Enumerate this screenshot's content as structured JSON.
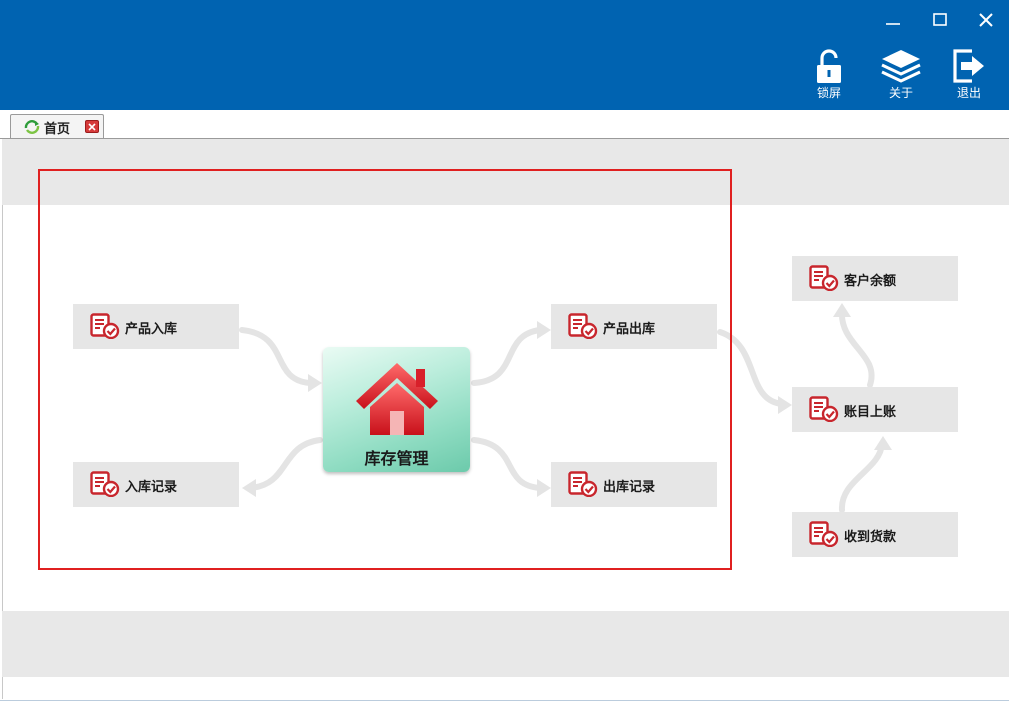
{
  "window": {
    "controls": {
      "minimize_icon": "minimize-icon",
      "maximize_icon": "maximize-icon",
      "close_icon": "close-icon"
    }
  },
  "toolbar": {
    "lock_label": "锁屏",
    "about_label": "关于",
    "exit_label": "退出"
  },
  "tabs": [
    {
      "label": "首页",
      "icon": "home-refresh-icon",
      "closable": true
    }
  ],
  "center": {
    "label": "库存管理",
    "icon": "house-icon"
  },
  "nodes": {
    "product_in": "产品入库",
    "in_records": "入库记录",
    "product_out": "产品出库",
    "out_records": "出库记录",
    "customer_balance": "客户余额",
    "account_posting": "账目上账",
    "receive_payment": "收到货款"
  },
  "colors": {
    "titlebar": "#0063b1",
    "node_bg": "#e6e6e6",
    "highlight_border": "#e02020",
    "icon_red": "#c8262d",
    "band_gray": "#e8e8e8"
  }
}
